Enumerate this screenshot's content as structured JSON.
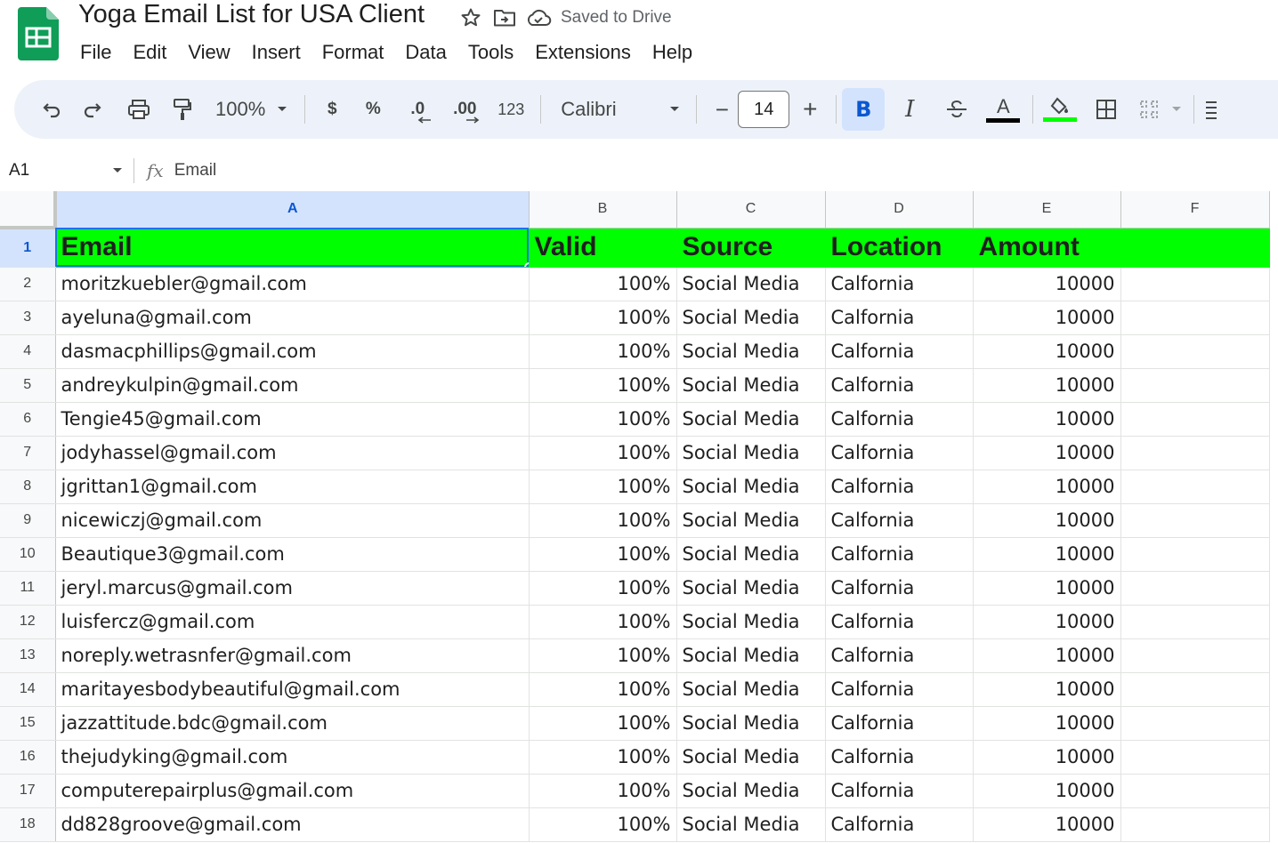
{
  "doc": {
    "title": "Yoga Email List for USA Client",
    "save_status": "Saved to Drive"
  },
  "menu": [
    "File",
    "Edit",
    "View",
    "Insert",
    "Format",
    "Data",
    "Tools",
    "Extensions",
    "Help"
  ],
  "toolbar": {
    "zoom": "100%",
    "currency": "$",
    "percent": "%",
    "decrease_decimal": ".0",
    "increase_decimal": ".00",
    "number_format": "123",
    "font": "Calibri",
    "minus": "−",
    "font_size": "14",
    "plus": "+",
    "bold": "B",
    "italic": "I",
    "text_color_letter": "A",
    "fill_color": "#00ff00"
  },
  "formula_bar": {
    "cell_ref": "A1",
    "fx": "fx",
    "content": "Email"
  },
  "columns": [
    "A",
    "B",
    "C",
    "D",
    "E",
    "F"
  ],
  "header_row": {
    "num": "1",
    "cells": [
      "Email",
      "Valid",
      "Source",
      "Location",
      "Amount",
      ""
    ]
  },
  "rows": [
    {
      "num": "2",
      "email": "moritzkuebler@gmail.com",
      "valid": "100%",
      "source": "Social Media",
      "location": "Calfornia",
      "amount": "10000"
    },
    {
      "num": "3",
      "email": "ayeluna@gmail.com",
      "valid": "100%",
      "source": "Social Media",
      "location": "Calfornia",
      "amount": "10000"
    },
    {
      "num": "4",
      "email": "dasmacphillips@gmail.com",
      "valid": "100%",
      "source": "Social Media",
      "location": "Calfornia",
      "amount": "10000"
    },
    {
      "num": "5",
      "email": "andreykulpin@gmail.com",
      "valid": "100%",
      "source": "Social Media",
      "location": "Calfornia",
      "amount": "10000"
    },
    {
      "num": "6",
      "email": "Tengie45@gmail.com",
      "valid": "100%",
      "source": "Social Media",
      "location": "Calfornia",
      "amount": "10000"
    },
    {
      "num": "7",
      "email": "jodyhassel@gmail.com",
      "valid": "100%",
      "source": "Social Media",
      "location": "Calfornia",
      "amount": "10000"
    },
    {
      "num": "8",
      "email": "jgrittan1@gmail.com",
      "valid": "100%",
      "source": "Social Media",
      "location": "Calfornia",
      "amount": "10000"
    },
    {
      "num": "9",
      "email": "nicewiczj@gmail.com",
      "valid": "100%",
      "source": "Social Media",
      "location": "Calfornia",
      "amount": "10000"
    },
    {
      "num": "10",
      "email": "Beautique3@gmail.com",
      "valid": "100%",
      "source": "Social Media",
      "location": "Calfornia",
      "amount": "10000"
    },
    {
      "num": "11",
      "email": "jeryl.marcus@gmail.com",
      "valid": "100%",
      "source": "Social Media",
      "location": "Calfornia",
      "amount": "10000"
    },
    {
      "num": "12",
      "email": "luisfercz@gmail.com",
      "valid": "100%",
      "source": "Social Media",
      "location": "Calfornia",
      "amount": "10000"
    },
    {
      "num": "13",
      "email": "noreply.wetrasnfer@gmail.com",
      "valid": "100%",
      "source": "Social Media",
      "location": "Calfornia",
      "amount": "10000"
    },
    {
      "num": "14",
      "email": "maritayesbodybeautiful@gmail.com",
      "valid": "100%",
      "source": "Social Media",
      "location": "Calfornia",
      "amount": "10000"
    },
    {
      "num": "15",
      "email": "jazzattitude.bdc@gmail.com",
      "valid": "100%",
      "source": "Social Media",
      "location": "Calfornia",
      "amount": "10000"
    },
    {
      "num": "16",
      "email": "thejudyking@gmail.com",
      "valid": "100%",
      "source": "Social Media",
      "location": "Calfornia",
      "amount": "10000"
    },
    {
      "num": "17",
      "email": "computerepairplus@gmail.com",
      "valid": "100%",
      "source": "Social Media",
      "location": "Calfornia",
      "amount": "10000"
    },
    {
      "num": "18",
      "email": "dd828groove@gmail.com",
      "valid": "100%",
      "source": "Social Media",
      "location": "Calfornia",
      "amount": "10000"
    }
  ]
}
